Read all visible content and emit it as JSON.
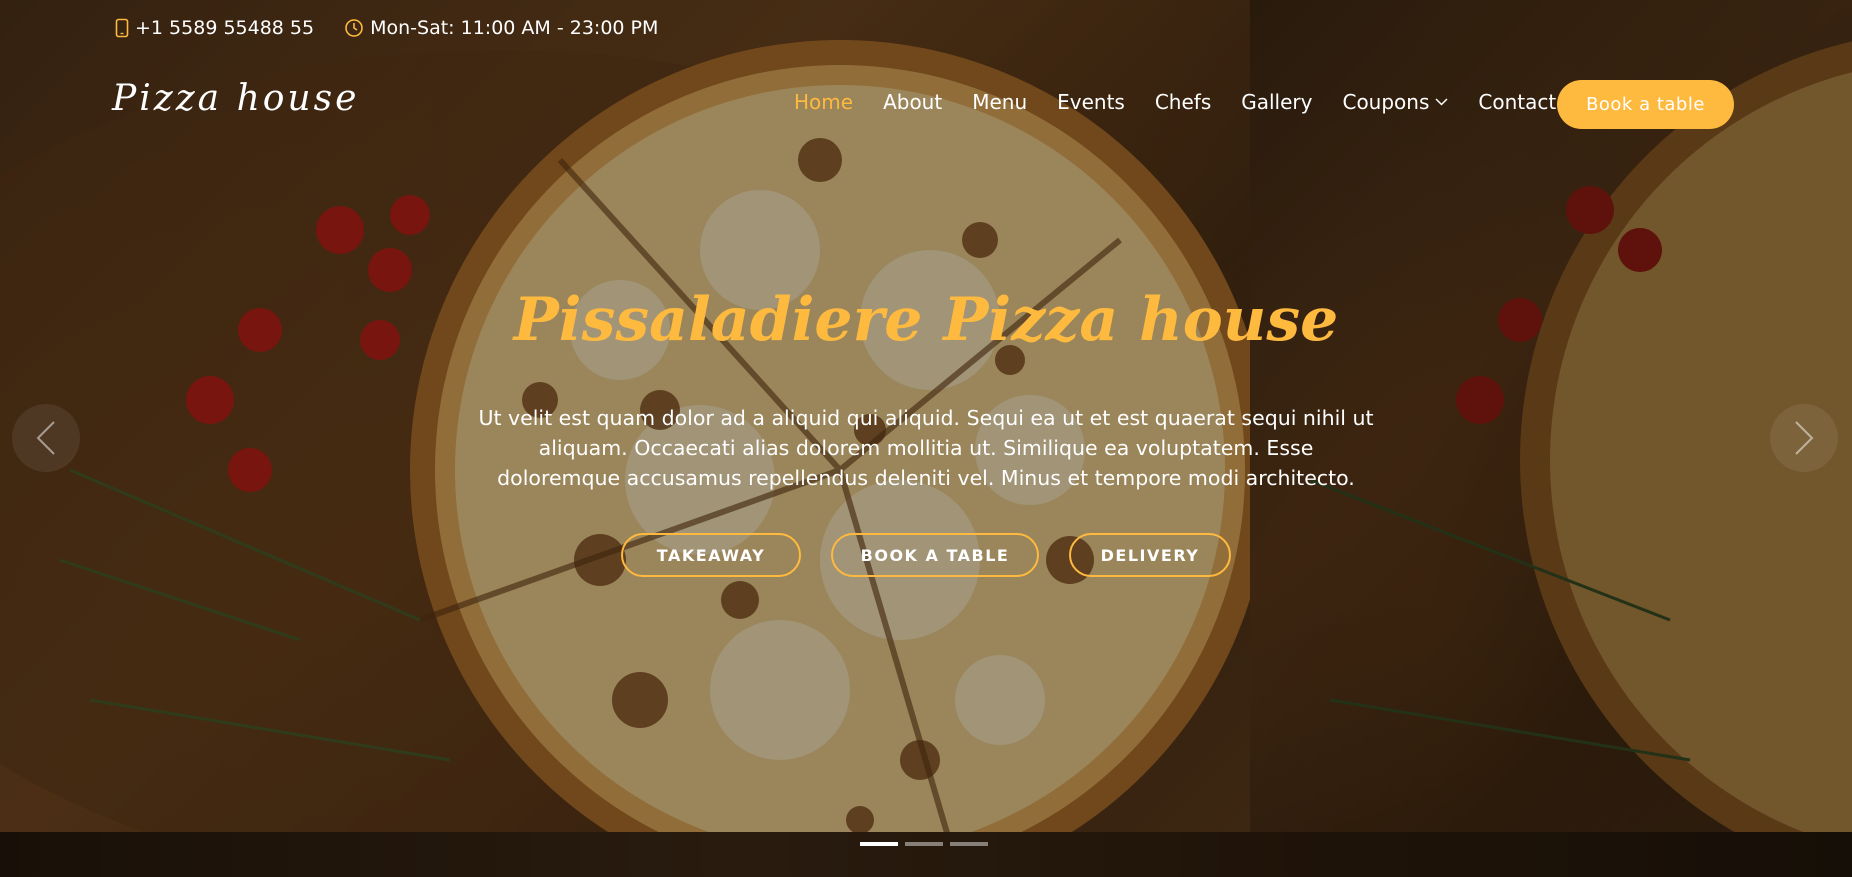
{
  "topbar": {
    "phone": "+1 5589 55488 55",
    "hours": "Mon-Sat: 11:00 AM - 23:00 PM"
  },
  "header": {
    "logo": "Pizza house",
    "nav": [
      {
        "label": "Home",
        "active": true
      },
      {
        "label": "About"
      },
      {
        "label": "Menu"
      },
      {
        "label": "Events"
      },
      {
        "label": "Chefs"
      },
      {
        "label": "Gallery"
      },
      {
        "label": "Coupons",
        "dropdown": true
      },
      {
        "label": "Contact"
      }
    ],
    "book_button": "Book a table"
  },
  "hero": {
    "title": "Pissaladiere Pizza house",
    "text": "Ut velit est quam dolor ad a aliquid qui aliquid. Sequi ea ut et est quaerat sequi nihil ut aliquam. Occaecati alias dolorem mollitia ut. Similique ea voluptatem. Esse doloremque accusamus repellendus deleniti vel. Minus et tempore modi architecto.",
    "buttons": [
      "TAKEAWAY",
      "BOOK A TABLE",
      "DELIVERY"
    ]
  },
  "carousel": {
    "slides": 3,
    "active_index": 0
  },
  "colors": {
    "accent": "#feb93f",
    "text": "#ffffff"
  },
  "icons": {
    "phone": "phone-icon",
    "hours": "clock-icon",
    "dropdown": "chevron-down-icon",
    "prev": "chevron-left-icon",
    "next": "chevron-right-icon"
  }
}
